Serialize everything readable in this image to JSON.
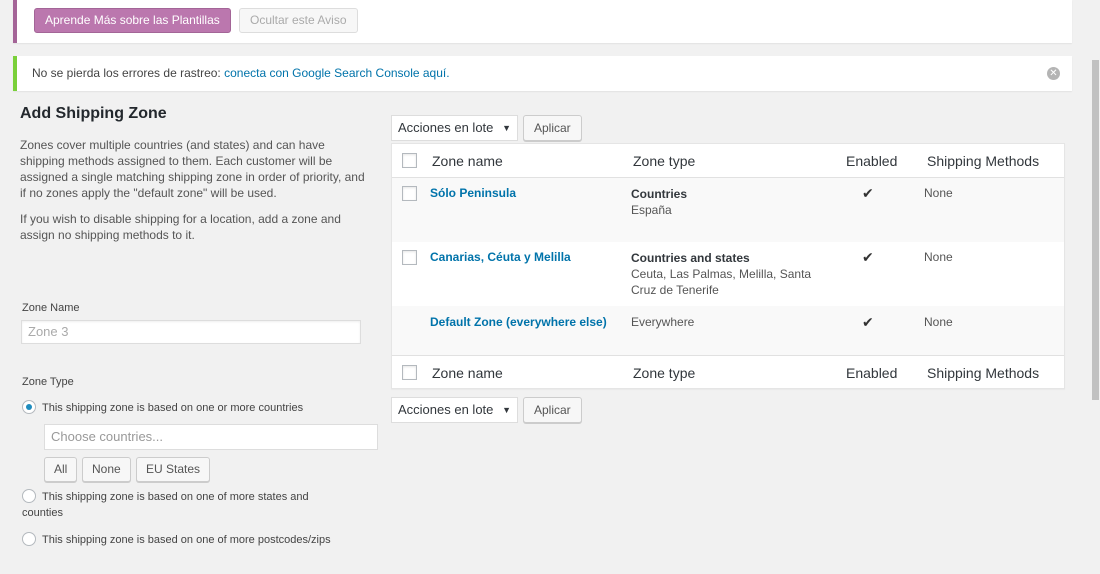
{
  "promo": {
    "learn_more_label": "Aprende Más sobre las Plantillas",
    "hide_label": "Ocultar este Aviso"
  },
  "notice": {
    "text": "No se pierda los errores de rastreo: ",
    "link": "conecta con Google Search Console aquí."
  },
  "form": {
    "title": "Add Shipping Zone",
    "description1": "Zones cover multiple countries (and states) and can have shipping methods assigned to them. Each customer will be assigned a single matching shipping zone in order of priority, and if no zones apply the \"default zone\" will be used.",
    "description2": "If you wish to disable shipping for a location, add a zone and assign no shipping methods to it.",
    "zone_name_label": "Zone Name",
    "zone_name_placeholder": "Zone 3",
    "zone_type_label": "Zone Type",
    "radio_countries": "This shipping zone is based on one or more countries",
    "countries_placeholder": "Choose countries...",
    "btn_all": "All",
    "btn_none": "None",
    "btn_eu": "EU States",
    "radio_states": "This shipping zone is based on one of more states and counties",
    "radio_postcodes": "This shipping zone is based on one of more postcodes/zips"
  },
  "bulk": {
    "action_label": "Acciones en lote",
    "apply_label": "Aplicar"
  },
  "table": {
    "columns": [
      "Zone name",
      "Zone type",
      "Enabled",
      "Shipping Methods"
    ],
    "rows": [
      {
        "name": "Sólo Peninsula",
        "type": "Countries",
        "detail": "España",
        "enabled": "✔",
        "methods": "None"
      },
      {
        "name": "Canarias, Céuta y Melilla",
        "type": "Countries and states",
        "detail": "Ceuta, Las Palmas, Melilla, Santa Cruz de Tenerife",
        "enabled": "✔",
        "methods": "None"
      },
      {
        "name": "Default Zone (everywhere else)",
        "type": "",
        "detail": "Everywhere",
        "enabled": "✔",
        "methods": "None"
      }
    ]
  }
}
